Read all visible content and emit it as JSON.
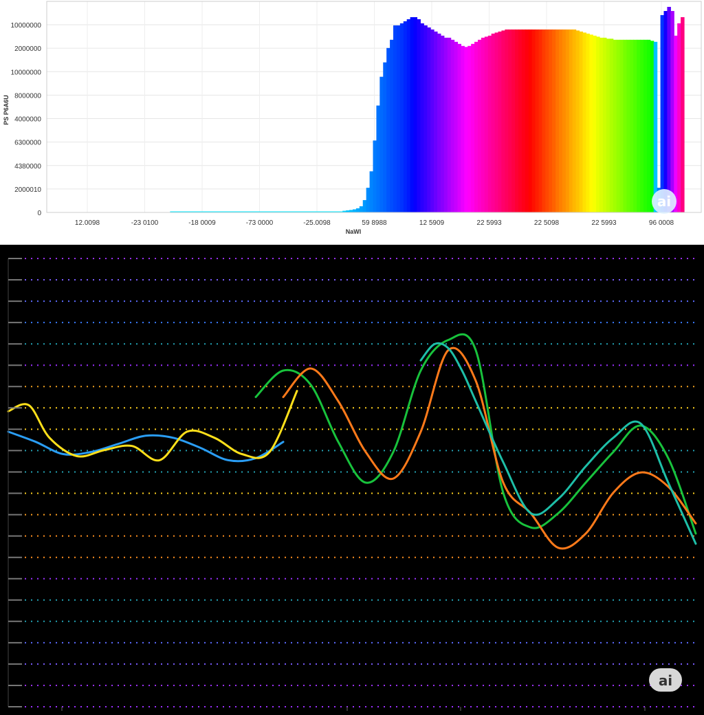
{
  "chart_data": [
    {
      "type": "bar",
      "title": "",
      "xlabel": "NaWl",
      "ylabel": "PS P6A6U",
      "x_tick_labels": [
        "12.0098",
        "-23 0100",
        "-18 0009",
        "-73 0000",
        "-25.0098",
        "59 8988",
        "12 5909",
        "22 5993",
        "22 5098",
        "22 5993",
        "96 0008"
      ],
      "y_tick_labels": [
        "0",
        "2000010",
        "4380000",
        "6300000",
        "4000000",
        "8000000",
        "10000000",
        "2000000",
        "10000000"
      ],
      "ylim": [
        0,
        10
      ],
      "grid": true,
      "color_note": "spectrum gradient: cyan, blue, magenta, red, yellow, green, cyan",
      "values": [
        0,
        0,
        0,
        0,
        0,
        0,
        0,
        0,
        0,
        0,
        0,
        0,
        0,
        0,
        0,
        0,
        0,
        0,
        0,
        0,
        0,
        0,
        0,
        0,
        0,
        0,
        0,
        0,
        0,
        0,
        0,
        0,
        0.05,
        0.05,
        0.05,
        0.05,
        0.05,
        0.05,
        0.05,
        0.05,
        0.05,
        0.05,
        0.05,
        0.05,
        0.05,
        0.05,
        0.05,
        0.05,
        0.05,
        0.05,
        0.05,
        0.05,
        0.05,
        0.05,
        0.05,
        0.05,
        0.05,
        0.05,
        0.05,
        0.05,
        0.05,
        0.05,
        0.05,
        0.05,
        0.05,
        0.05,
        0.05,
        0.05,
        0.05,
        0.05,
        0.05,
        0.05,
        0.05,
        0.05,
        0.05,
        0.05,
        0.05,
        0.05,
        0.05,
        0.05,
        0.05,
        0.05,
        0.05,
        0.08,
        0.1,
        0.12,
        0.15,
        0.2,
        0.3,
        0.6,
        1.2,
        2.0,
        3.5,
        5.2,
        6.6,
        7.3,
        8.0,
        8.4,
        9.1,
        9.1,
        9.2,
        9.3,
        9.4,
        9.5,
        9.5,
        9.4,
        9.2,
        9.1,
        9.0,
        8.9,
        8.8,
        8.7,
        8.6,
        8.5,
        8.5,
        8.4,
        8.3,
        8.2,
        8.1,
        8.05,
        8.1,
        8.2,
        8.3,
        8.4,
        8.5,
        8.55,
        8.6,
        8.7,
        8.75,
        8.8,
        8.85,
        8.9,
        8.9,
        8.9,
        8.9,
        8.9,
        8.9,
        8.9,
        8.9,
        8.9,
        8.9,
        8.9,
        8.9,
        8.9,
        8.9,
        8.9,
        8.9,
        8.9,
        8.9,
        8.9,
        8.9,
        8.9,
        8.85,
        8.8,
        8.75,
        8.7,
        8.65,
        8.6,
        8.55,
        8.5,
        8.5,
        8.45,
        8.45,
        8.4,
        8.4,
        8.4,
        8.4,
        8.4,
        8.4,
        8.4,
        8.4,
        8.4,
        8.4,
        8.4,
        8.35,
        8.3,
        1.2,
        9.6,
        9.8,
        10.0,
        9.8,
        8.6,
        9.2,
        9.5
      ]
    },
    {
      "type": "line",
      "title": "",
      "xlabel": "",
      "ylabel": "",
      "x_range": [
        0,
        100
      ],
      "ylim": [
        0,
        22
      ],
      "gridline_colors": [
        "#9b30ff",
        "#7a5cff",
        "#5c6cff",
        "#3a7bff",
        "#23a3b5",
        "#9b30ff",
        "#f0a020",
        "#ffd21f",
        "#ffd21f",
        "#23a3b5",
        "#23a3b5",
        "#ffd21f",
        "#ffa020",
        "#ff9020",
        "#ff9020",
        "#9b30ff",
        "#23a3b5",
        "#23a3b5",
        "#5c6cff",
        "#7a5cff",
        "#9b30ff",
        "#9b30ff"
      ],
      "series": [
        {
          "color": "#2a9df4",
          "x": [
            0,
            4,
            8,
            12,
            16,
            20,
            24,
            28,
            32,
            36,
            40
          ],
          "y": [
            13.5,
            13,
            12.4,
            12.5,
            12.9,
            13.3,
            13.2,
            12.7,
            12.1,
            12.2,
            13
          ]
        },
        {
          "color": "#ffe01a",
          "x": [
            0,
            3,
            6,
            10,
            14,
            18,
            22,
            26,
            30,
            34,
            38,
            42
          ],
          "y": [
            14.5,
            14.8,
            13.2,
            12.3,
            12.6,
            12.8,
            12.1,
            13.5,
            13.2,
            12.4,
            12.5,
            15.5
          ]
        },
        {
          "color": "#18c23c",
          "x": [
            36,
            40,
            44,
            48,
            52,
            56,
            60,
            64,
            68,
            72,
            76,
            80,
            84,
            88,
            92,
            96,
            100
          ],
          "y": [
            15.2,
            16.5,
            15.8,
            13,
            11,
            12.5,
            16.5,
            18,
            17.5,
            10.5,
            8.8,
            9.5,
            11,
            12.5,
            13.8,
            12.2,
            8.5
          ]
        },
        {
          "color": "#ff7a1a",
          "x": [
            40,
            44,
            48,
            52,
            56,
            60,
            64,
            68,
            72,
            76,
            80,
            84,
            88,
            92,
            96,
            100
          ],
          "y": [
            15.2,
            16.6,
            15,
            12.5,
            11.2,
            13.5,
            17.5,
            16,
            11,
            9.5,
            7.8,
            8.5,
            10.5,
            11.5,
            10.8,
            9
          ]
        },
        {
          "color": "#1ebfa8",
          "x": [
            60,
            62,
            64,
            66,
            68,
            72,
            76,
            80,
            84,
            88,
            92,
            96,
            100
          ],
          "y": [
            17,
            17.8,
            17.6,
            16.5,
            15,
            12,
            9.5,
            10.2,
            11.8,
            13.2,
            13.9,
            11,
            8
          ]
        }
      ]
    }
  ]
}
